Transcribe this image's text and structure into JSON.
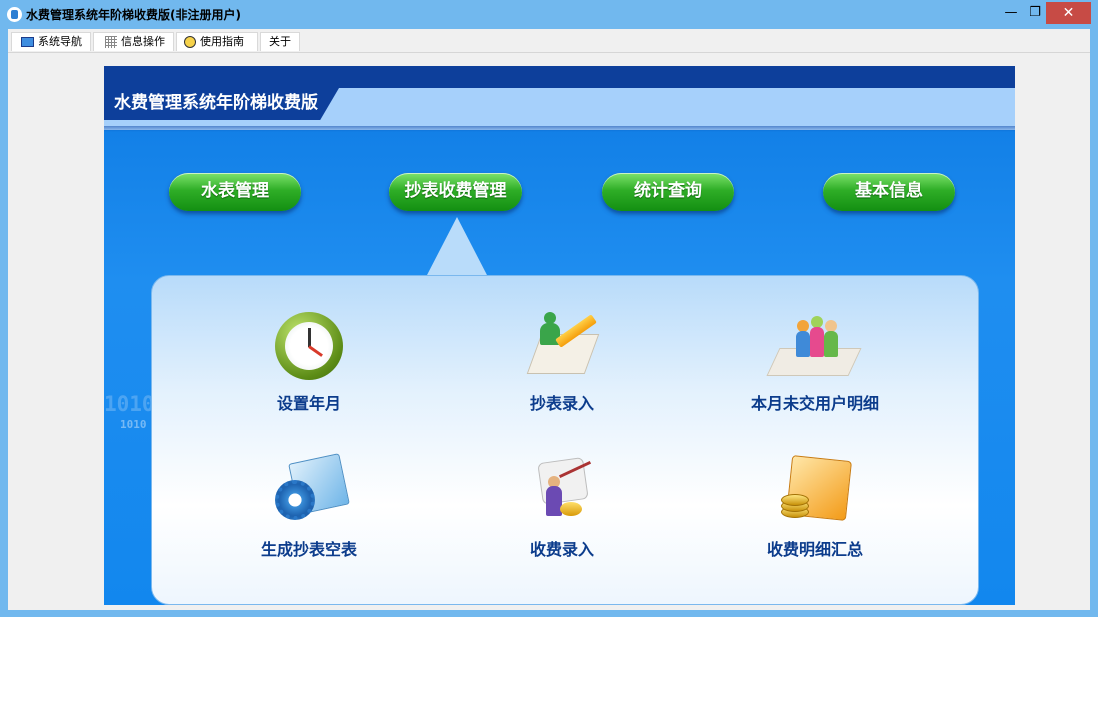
{
  "window": {
    "title": "水费管理系统年阶梯收费版(非注册用户)",
    "minimize_glyph": "—",
    "restore_glyph": "❐",
    "close_glyph": "✕"
  },
  "menu": {
    "items": [
      {
        "label": "系统导航",
        "icon": "monitor-icon"
      },
      {
        "label": "信息操作",
        "icon": "grid-icon"
      },
      {
        "label": "使用指南",
        "icon": "clock-icon"
      },
      {
        "label": "关于",
        "icon": ""
      }
    ]
  },
  "panel": {
    "title": "水费管理系统年阶梯收费版",
    "deco_text_1": "1010",
    "deco_text_2": "1010"
  },
  "nav_buttons": [
    {
      "label": "水表管理"
    },
    {
      "label": "抄表收费管理"
    },
    {
      "label": "统计查询"
    },
    {
      "label": "基本信息"
    }
  ],
  "functions": [
    {
      "label": "设置年月",
      "icon": "clock-icon"
    },
    {
      "label": "抄表录入",
      "icon": "notepad-pencil-icon"
    },
    {
      "label": "本月未交用户明细",
      "icon": "people-group-icon"
    },
    {
      "label": "生成抄表空表",
      "icon": "folder-gear-icon"
    },
    {
      "label": "收费录入",
      "icon": "scroll-coins-icon"
    },
    {
      "label": "收费明细汇总",
      "icon": "money-folder-icon"
    }
  ],
  "colors": {
    "titlebar": "#71b8ee",
    "panel_blue": "#1287ee",
    "header_dark": "#0d3f9b",
    "button_green": "#2fae27",
    "label_text": "#0c3c8c",
    "close_red": "#c74b45"
  }
}
